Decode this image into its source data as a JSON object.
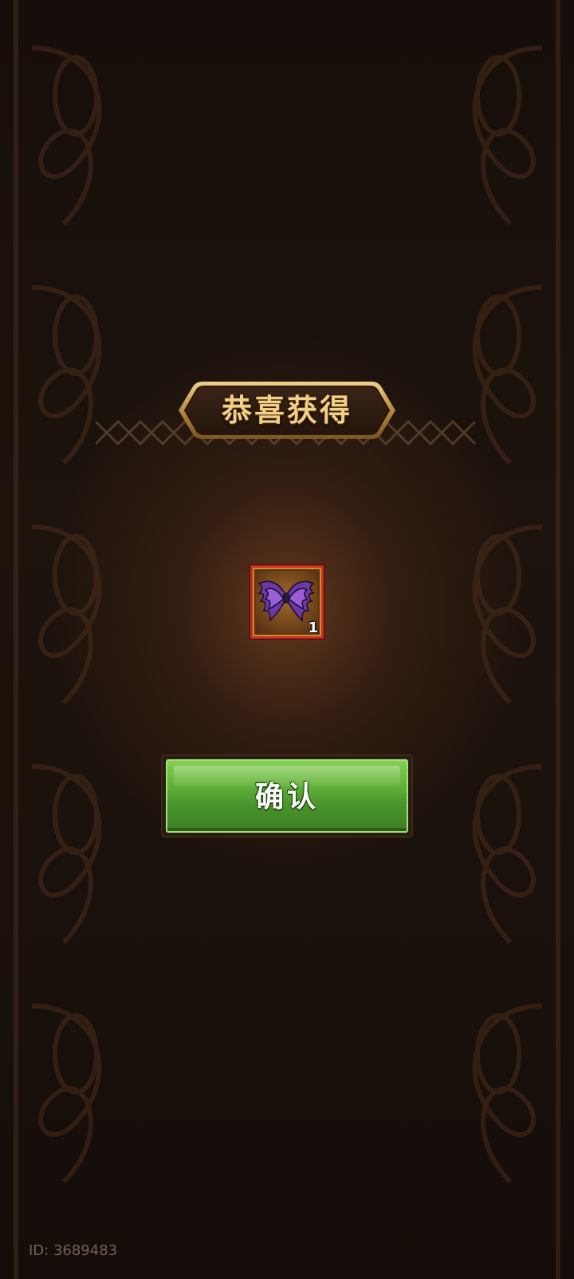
{
  "dialog": {
    "title": "恭喜获得",
    "confirm_label": "确认"
  },
  "reward": {
    "icon": "purple-wings-icon",
    "count": "1",
    "rarity_border_color": "#d22a22"
  },
  "footer": {
    "player_id": "ID: 3689483"
  },
  "colors": {
    "background": "#1a110c",
    "title_text": "#f2cf86",
    "button_green": "#5fae38"
  }
}
